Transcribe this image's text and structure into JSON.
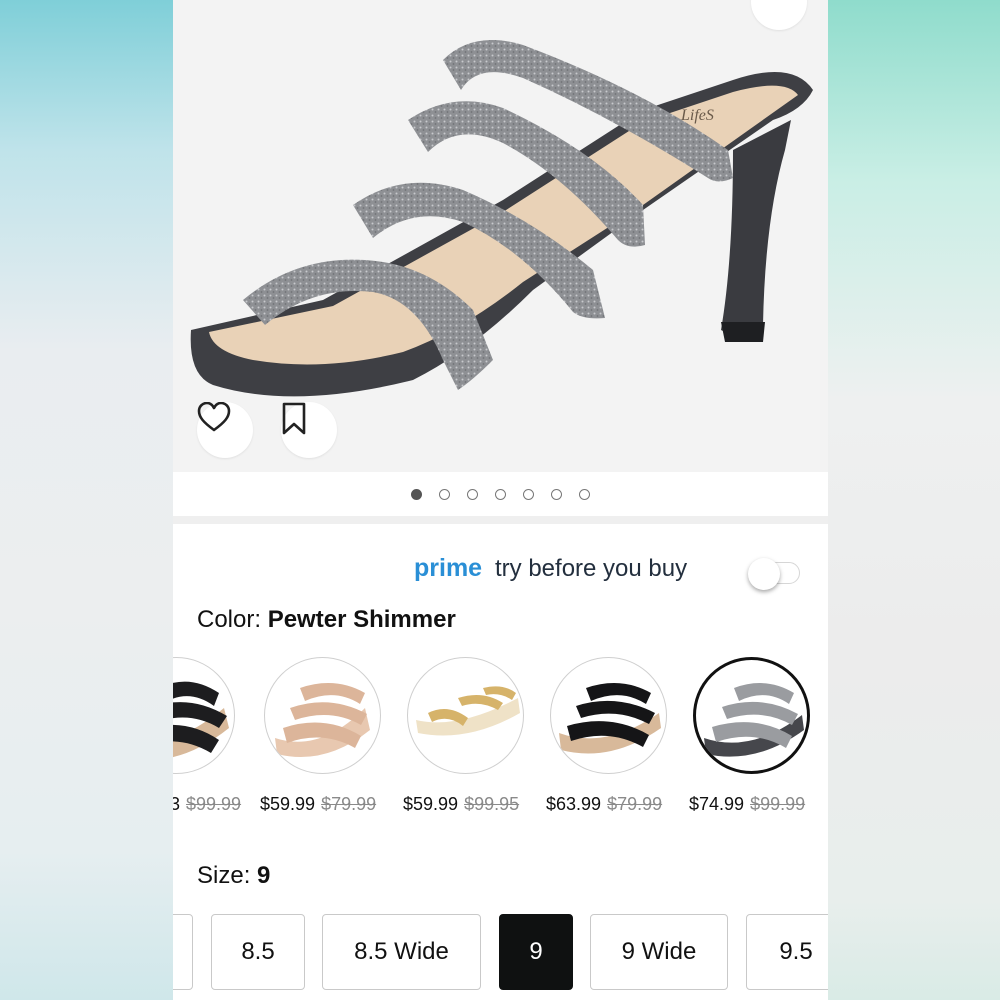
{
  "product_image": {
    "carousel_total": 7,
    "carousel_active": 1,
    "brand_mark": "LifeS"
  },
  "actions": {
    "share_icon": "share-icon",
    "wishlist_icon": "heart-icon",
    "save_icon": "bookmark-icon"
  },
  "prime": {
    "brand": "prime",
    "label": "try before you buy",
    "toggle_on": false,
    "brand_color": "#2a8fd6"
  },
  "color": {
    "label": "Color:",
    "selected": "Pewter Shimmer",
    "options": [
      {
        "name": "black",
        "price": "",
        "list_price": "$99.99",
        "partial_price": "3"
      },
      {
        "name": "nude",
        "price": "$59.99",
        "list_price": "$79.99"
      },
      {
        "name": "gold",
        "price": "$59.99",
        "list_price": "$99.95"
      },
      {
        "name": "black-patent",
        "price": "$63.99",
        "list_price": "$79.99"
      },
      {
        "name": "Pewter Shimmer",
        "price": "$74.99",
        "list_price": "$99.99",
        "selected": true
      }
    ]
  },
  "size": {
    "label": "Size:",
    "selected": "9",
    "options": [
      "",
      "8.5",
      "8.5 Wide",
      "9",
      "9 Wide",
      "9.5"
    ]
  }
}
